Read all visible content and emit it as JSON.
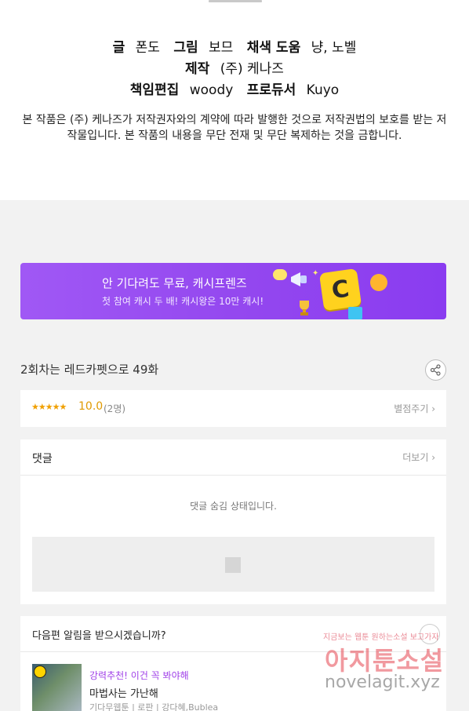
{
  "credits": {
    "writer_label": "글",
    "writer": "폰도",
    "art_label": "그림",
    "art": "보므",
    "color_label": "채색 도움",
    "color": "냥, 노벨",
    "production_label": "제작",
    "production": "(주) 케나즈",
    "editor_label": "책임편집",
    "editor": "woody",
    "producer_label": "프로듀서",
    "producer": "Kuyo"
  },
  "copyright": "본 작품은 (주) 케나즈가 저작권자와의 계약에 따라 발행한 것으로 저작권법의 보호를 받는 저작물입니다. 본 작품의 내용을 무단 전재 및 무단 복제하는 것을 금합니다.",
  "banner": {
    "headline": "안 기다려도 무료, 캐시프렌즈",
    "subline": "첫 참여 캐시 두 배! 캐시왕은 10만 캐시!",
    "coin_letter": "C"
  },
  "series_info": {
    "text": "2회차는 레드카펫으로 49화"
  },
  "rating": {
    "stars": "★★★★★",
    "score": "10.0",
    "count": "(2명)",
    "rate_button": "별점주기 ›"
  },
  "comments": {
    "title": "댓글",
    "more": "더보기 ›",
    "hidden_message": "댓글 숨김 상태입니다."
  },
  "next_alert": {
    "question": "다음편 알림을 받으시겠습니까?",
    "recommend_label": "강력추천! 이건 꼭 봐야해",
    "work_title": "마법사는 가난해",
    "work_meta": "기다무웹툰 | 로판 | 강다혜,Bublea"
  },
  "watermark": {
    "line1": "지금보는 웹툰 원하는소설 보고가자",
    "line2": "아지툰소설",
    "line3": "novelagit.xyz"
  },
  "colors": {
    "banner_accent": "#9448ef",
    "rating_star": "#f0a000",
    "recommend_text": "#a040e8"
  },
  "icons": {
    "share": "share-icon",
    "bell": "bell-icon",
    "clock_badge": "clock-icon",
    "image_placeholder": "image-placeholder-icon"
  }
}
